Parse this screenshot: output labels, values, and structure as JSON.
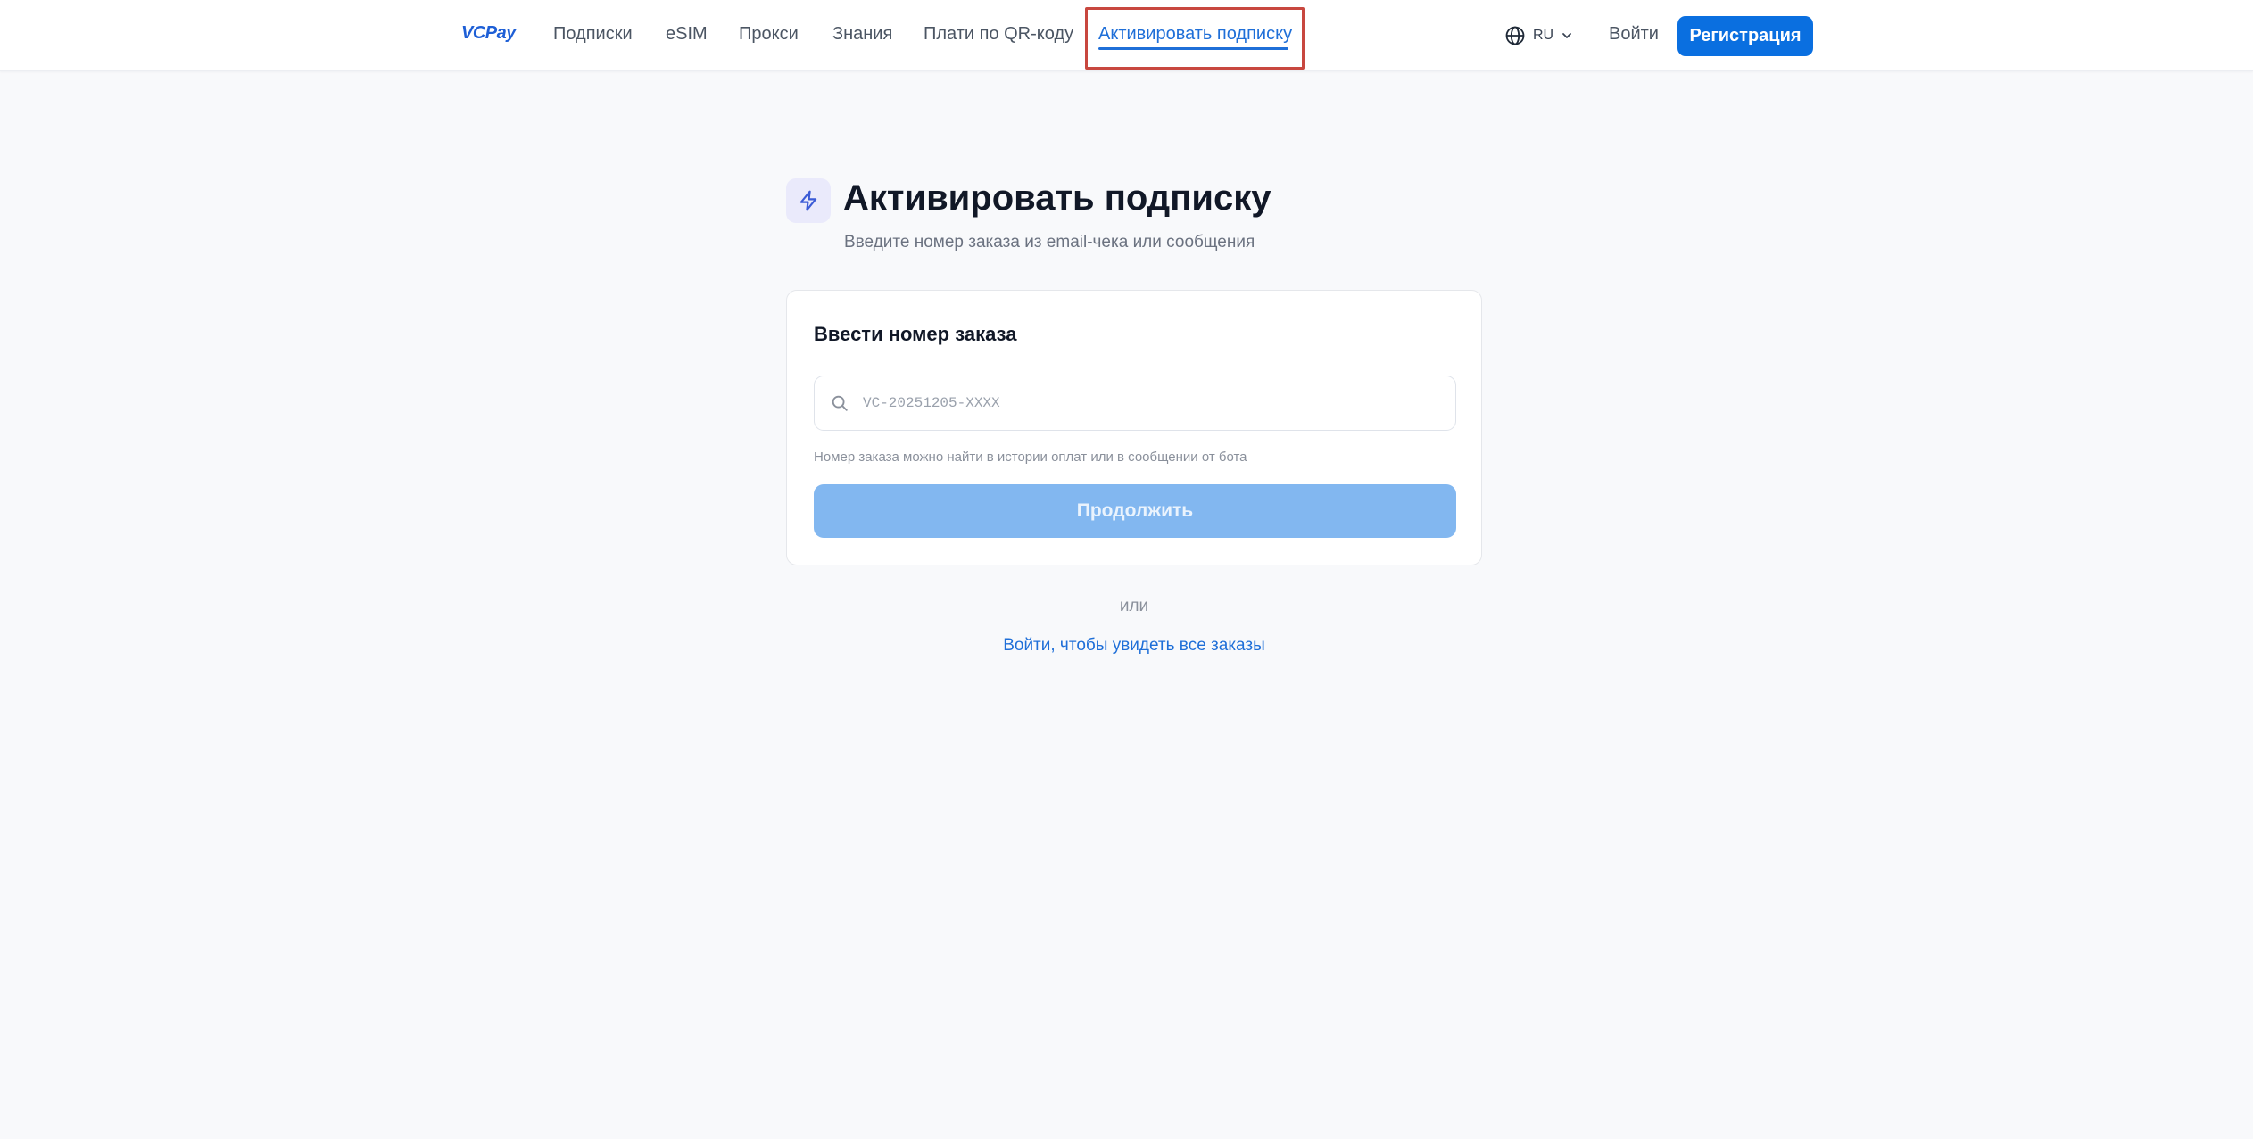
{
  "header": {
    "logo": "VCPay",
    "nav": [
      {
        "label": "Подписки"
      },
      {
        "label": "eSIM"
      },
      {
        "label": "Прокси"
      },
      {
        "label": "Знания"
      },
      {
        "label": "Плати по QR-коду"
      },
      {
        "label": "Активировать подписку",
        "active": true
      }
    ],
    "language": {
      "code": "RU",
      "icon": "globe-icon"
    },
    "login_label": "Войти",
    "register_label": "Регистрация"
  },
  "main": {
    "icon": "lightning-icon",
    "title": "Активировать подписку",
    "subtitle": "Введите номер заказа из email-чека или сообщения",
    "card": {
      "title": "Ввести номер заказа",
      "input": {
        "value": "",
        "placeholder": "VC-20251205-XXXX",
        "icon": "search-icon"
      },
      "hint": "Номер заказа можно найти в истории оплат или в сообщении от бота",
      "continue_label": "Продолжить",
      "continue_disabled": true
    },
    "or_text": "или",
    "login_orders_link": "Войти, чтобы увидеть все заказы"
  },
  "colors": {
    "accent": "#0a6fe0",
    "active_nav": "#1f6fd8",
    "highlight_box": "#c8473f",
    "disabled_button": "#82b7f0",
    "background": "#f8f9fb"
  }
}
